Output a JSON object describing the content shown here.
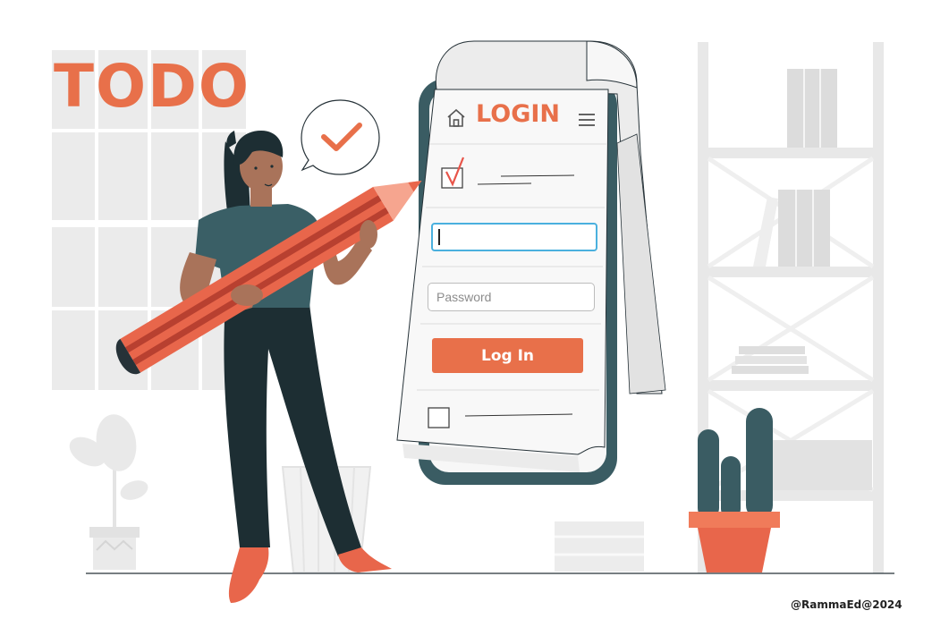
{
  "illustration": {
    "todo_title": "TODO",
    "credit": "@RammaEd@2024"
  },
  "login_card": {
    "title": "LOGIN",
    "username_value": "",
    "password_placeholder": "Password",
    "login_button_label": "Log In",
    "remember_checked": true,
    "second_checkbox_checked": false
  },
  "colors": {
    "accent": "#e8704a",
    "phone_frame": "#3a5c63",
    "focus_border": "#4ab0de",
    "pencil_red": "#e8664b",
    "pencil_dark": "#b84030",
    "pants": "#1d2e33",
    "shirt": "#3a5f66",
    "skin": "#a9735a"
  },
  "icons": {
    "home": "home-icon",
    "menu": "hamburger-menu-icon",
    "check": "checkmark-icon"
  }
}
